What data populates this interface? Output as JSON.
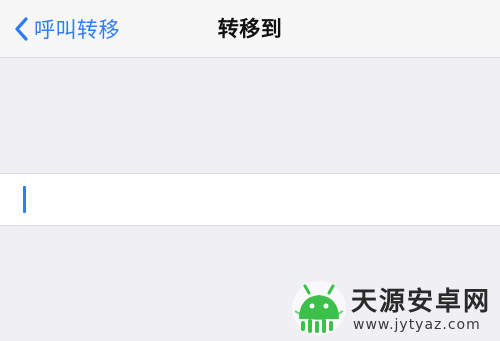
{
  "navbar": {
    "back_label": "呼叫转移",
    "back_icon": "chevron-left-icon",
    "title": "转移到"
  },
  "input": {
    "value": "",
    "placeholder": ""
  },
  "watermark": {
    "title": "天源安卓网",
    "url": "www.jytyaz.com"
  },
  "colors": {
    "accent": "#2f7cf6",
    "background": "#efeff4",
    "navbar": "#f7f7f7",
    "cell": "#ffffff",
    "logo_green": "#3cc04a"
  }
}
